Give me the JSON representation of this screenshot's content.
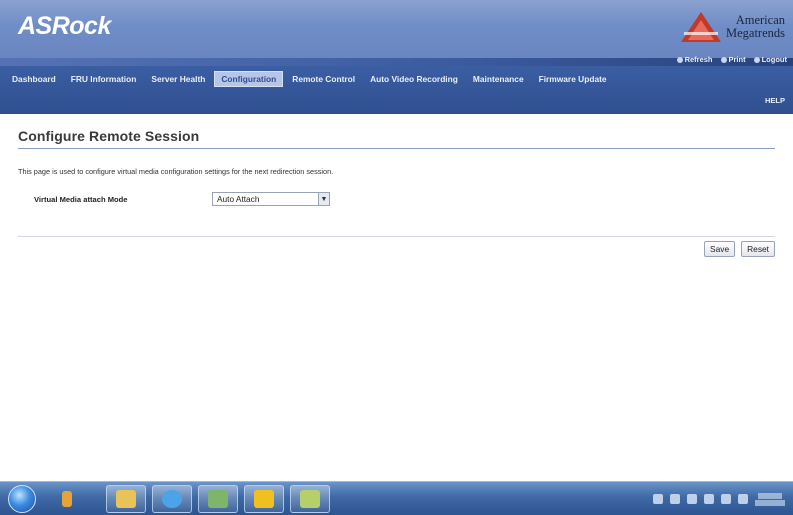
{
  "header": {
    "logo_text": "ASRock",
    "vendor_line1": "American",
    "vendor_line2": "Megatrends",
    "utility_links": [
      "Refresh",
      "Print",
      "Logout"
    ]
  },
  "nav": {
    "items": [
      {
        "label": "Dashboard",
        "active": false
      },
      {
        "label": "FRU Information",
        "active": false
      },
      {
        "label": "Server Health",
        "active": false
      },
      {
        "label": "Configuration",
        "active": true
      },
      {
        "label": "Remote Control",
        "active": false
      },
      {
        "label": "Auto Video Recording",
        "active": false
      },
      {
        "label": "Maintenance",
        "active": false
      },
      {
        "label": "Firmware Update",
        "active": false
      }
    ],
    "help_label": "HELP"
  },
  "main": {
    "title": "Configure Remote Session",
    "description": "This page is used to configure virtual media configuration settings for the next redirection session.",
    "field_label": "Virtual Media attach Mode",
    "field_value": "Auto Attach",
    "save_label": "Save",
    "reset_label": "Reset"
  },
  "colors": {
    "banner": "#6f8dc7",
    "navbar": "#2f4f8f",
    "active_tab": "#b7c6e6",
    "title_rule": "#8a9bbd"
  }
}
